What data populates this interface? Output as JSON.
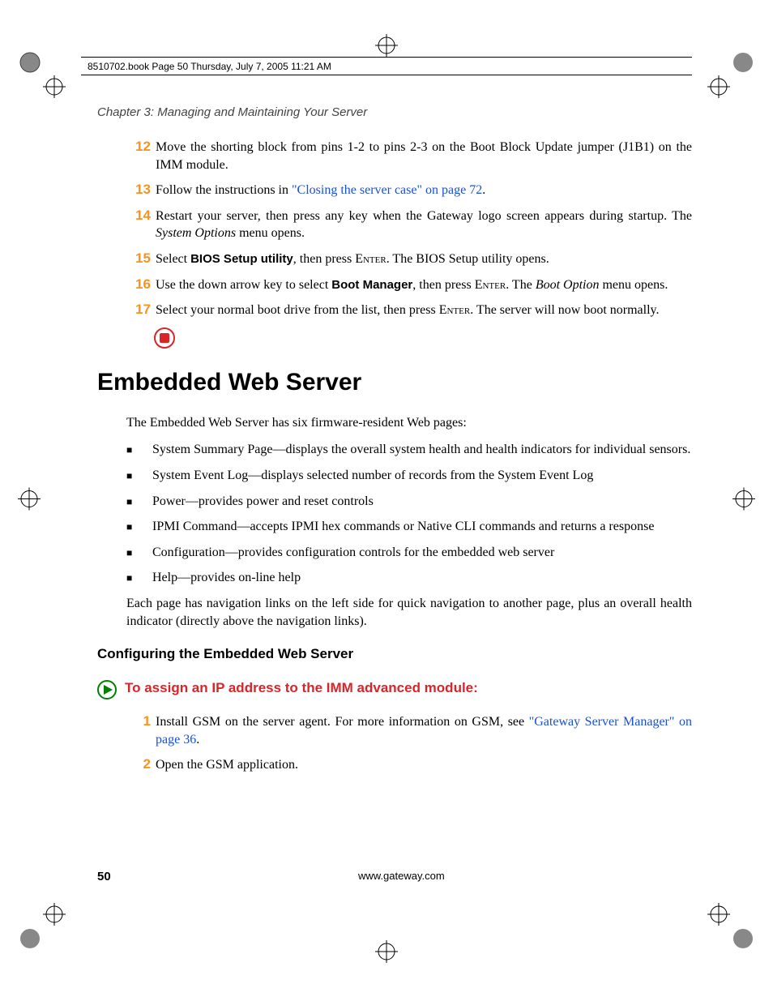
{
  "header": "8510702.book  Page 50  Thursday, July 7, 2005  11:21 AM",
  "chapter_label": "Chapter 3: Managing and Maintaining Your Server",
  "steps_top": [
    {
      "n": "12",
      "parts": [
        {
          "t": "Move the shorting block from pins 1-2 to pins 2-3 on the Boot Block Update jumper (J1B1) on the IMM module."
        }
      ]
    },
    {
      "n": "13",
      "parts": [
        {
          "t": "Follow the instructions in "
        },
        {
          "t": "\"Closing the server case\" on page 72",
          "link": true
        },
        {
          "t": "."
        }
      ]
    },
    {
      "n": "14",
      "parts": [
        {
          "t": "Restart your server, then press any key when the Gateway logo screen appears during startup. The "
        },
        {
          "t": "System Options",
          "i": true
        },
        {
          "t": " menu opens."
        }
      ]
    },
    {
      "n": "15",
      "parts": [
        {
          "t": "Select "
        },
        {
          "t": "BIOS Setup utility",
          "bs": true
        },
        {
          "t": ", then press "
        },
        {
          "t": "Enter",
          "sc": true
        },
        {
          "t": ". The BIOS Setup utility opens."
        }
      ]
    },
    {
      "n": "16",
      "parts": [
        {
          "t": "Use the down arrow key to select "
        },
        {
          "t": "Boot Manager",
          "bs": true
        },
        {
          "t": ", then press "
        },
        {
          "t": "Enter",
          "sc": true
        },
        {
          "t": ". The "
        },
        {
          "t": "Boot Option",
          "i": true
        },
        {
          "t": " menu opens."
        }
      ]
    },
    {
      "n": "17",
      "parts": [
        {
          "t": "Select your normal boot drive from the list, then press "
        },
        {
          "t": "Enter",
          "sc": true
        },
        {
          "t": ". The server will now boot normally."
        }
      ]
    }
  ],
  "h1": "Embedded Web Server",
  "intro": "The Embedded Web Server has six firmware-resident Web pages:",
  "bullets": [
    "System Summary Page—displays the overall system health and health indicators for individual sensors.",
    "System Event Log—displays selected number of records from the System Event Log",
    "Power—provides power and reset controls",
    "IPMI Command—accepts IPMI hex commands or Native CLI commands and returns a response",
    "Configuration—provides configuration controls for the embedded web server",
    "Help—provides on-line help"
  ],
  "after_bullets": "Each page has navigation links on the left side for quick navigation to another page, plus an overall health indicator (directly above the navigation links).",
  "h2": "Configuring the Embedded Web Server",
  "task_title": "To assign an IP address to the IMM advanced module:",
  "steps_bottom": [
    {
      "n": "1",
      "parts": [
        {
          "t": "Install GSM on the server agent. For more information on GSM, see "
        },
        {
          "t": "\"Gateway Server Manager\" on page 36",
          "link": true
        },
        {
          "t": "."
        }
      ]
    },
    {
      "n": "2",
      "parts": [
        {
          "t": "Open the GSM application."
        }
      ]
    }
  ],
  "page_number": "50",
  "footer_url": "www.gateway.com"
}
